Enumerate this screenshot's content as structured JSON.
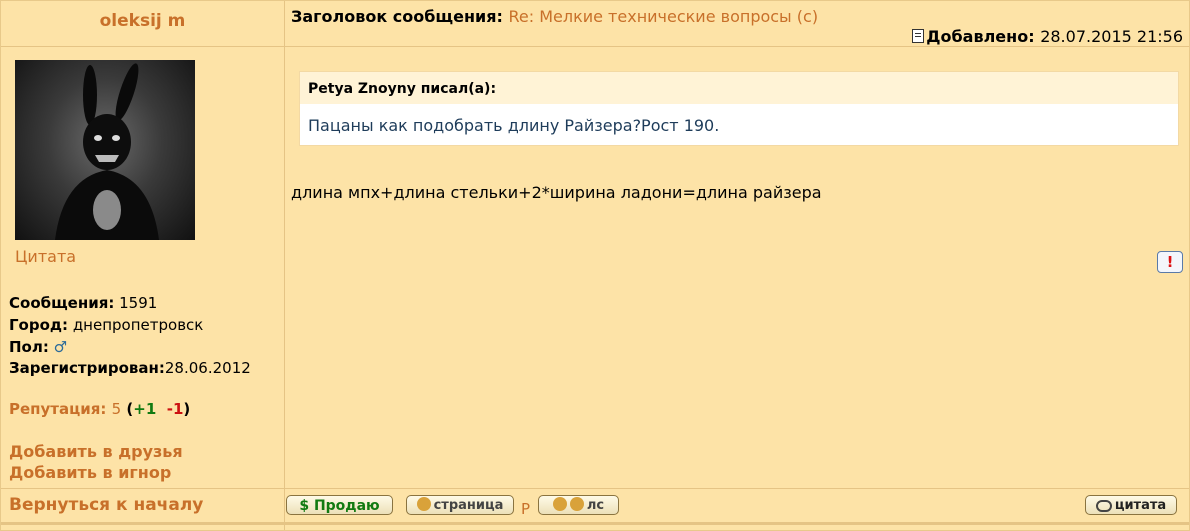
{
  "author": {
    "name": "oleksij m",
    "quote_link": "Цитата",
    "stats": {
      "posts_label": "Сообщения:",
      "posts_value": "1591",
      "city_label": "Город:",
      "city_value": "днепропетровск",
      "gender_label": "Пол:",
      "gender_symbol": "♂",
      "registered_label": "Зарегистрирован:",
      "registered_value": "28.06.2012"
    },
    "reputation": {
      "label": "Репутация:",
      "value": "5",
      "open": "(",
      "plus": "+1",
      "minus": "-1",
      "close": ")"
    },
    "add_friend": "Добавить в друзья",
    "add_ignore": "Добавить в игнор",
    "back_to_top": "Вернуться к началу"
  },
  "post": {
    "subject_label": "Заголовок сообщения:",
    "subject_text": "Re: Мелкие технические вопросы (с)",
    "added_label": "Добавлено:",
    "added_value": "28.07.2015 21:56",
    "quote": {
      "header": "Petya Znoyny писал(а):",
      "text": "Пацаны как подобрать длину Райзера?Рост 190."
    },
    "body": "длина мпх+длина стельки+2*ширина ладони=длина райзера",
    "report_symbol": "!"
  },
  "buttons": {
    "sell": "$ Продаю",
    "page": "страница",
    "p_letter": "Р",
    "pm": "лс",
    "quote": "цитата"
  },
  "colors": {
    "background": "#fde3a7",
    "accent": "#c8702a",
    "positive": "#117a11",
    "negative": "#cc1111"
  }
}
